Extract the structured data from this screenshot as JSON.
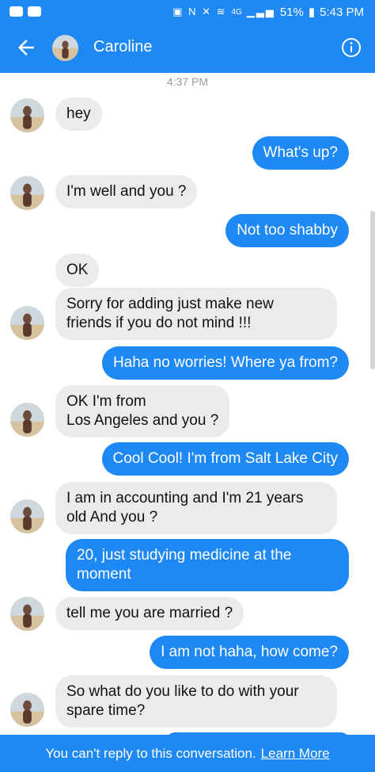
{
  "status_bar": {
    "battery": "51%",
    "time": "5:43 PM",
    "network": "4G"
  },
  "header": {
    "contact_name": "Caroline",
    "back_icon": "arrow-left-icon",
    "info_icon": "info-icon"
  },
  "conversation": {
    "timestamp": "4:37 PM",
    "messages": [
      {
        "from": "them",
        "text": [
          "hey"
        ]
      },
      {
        "from": "me",
        "text": [
          "What's up?"
        ]
      },
      {
        "from": "them",
        "text": [
          "I'm well and you ?"
        ]
      },
      {
        "from": "me",
        "text": [
          "Not too shabby"
        ]
      },
      {
        "from": "them",
        "text": [
          "OK"
        ]
      },
      {
        "from": "them",
        "text": [
          "Sorry for adding just make new",
          "friends if you do not mind !!!"
        ]
      },
      {
        "from": "me",
        "text": [
          "Haha no worries! Where ya from?"
        ]
      },
      {
        "from": "them",
        "text": [
          "OK I'm from",
          "Los Angeles and you ?"
        ]
      },
      {
        "from": "me",
        "text": [
          "Cool Cool! I'm from Salt Lake City"
        ]
      },
      {
        "from": "them",
        "text": [
          "I am in accounting and I'm 21 years",
          "old And you ?"
        ]
      },
      {
        "from": "me",
        "text": [
          "20, just studying medicine at the",
          "moment"
        ]
      },
      {
        "from": "them",
        "text": [
          "tell me you are married ?"
        ]
      },
      {
        "from": "me",
        "text": [
          "I am not haha, how come?"
        ]
      },
      {
        "from": "them",
        "text": [
          "So what do you like to do with your",
          "spare time?"
        ]
      }
    ]
  },
  "footer": {
    "notice": "You can't reply to this conversation.",
    "link_label": "Learn More"
  },
  "colors": {
    "brand_blue": "#1e88f5",
    "incoming_bubble": "#ebebeb"
  }
}
